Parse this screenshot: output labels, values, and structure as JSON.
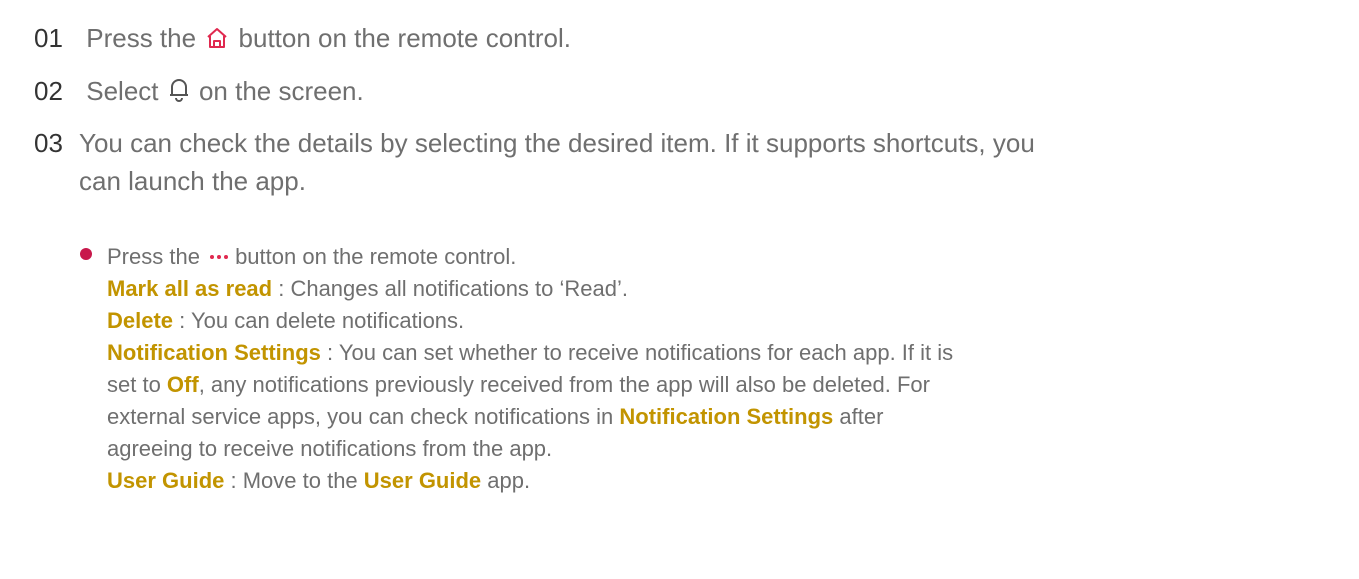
{
  "steps": [
    {
      "num": "01",
      "pre": "Press the",
      "icon": "home-icon",
      "post": "button on the remote control."
    },
    {
      "num": "02",
      "pre": "Select",
      "icon": "bell-icon",
      "post": "on the screen."
    },
    {
      "num": "03",
      "line1": "You can check the details by selecting the desired item. If it supports shortcuts, you",
      "line2": "can launch the app."
    }
  ],
  "bullet": {
    "press_pre": "Press the",
    "icon": "more-dots-icon",
    "press_post": "button on the remote control.",
    "items": [
      {
        "term": "Mark all as read",
        "desc": " : Changes all notifications to ‘Read’."
      },
      {
        "term": "Delete",
        "desc": " : You can delete notifications."
      }
    ],
    "notif": {
      "term": "Notification Settings",
      "desc1": " : You can set whether to receive notifications for each app. If it is",
      "desc2_pre": "set to ",
      "off": "Off",
      "desc2_post": ", any notifications previously received from the app will also be deleted. For",
      "desc3_pre": "external service apps, you can check notifications in ",
      "term2": "Notification Settings",
      "desc3_post": " after",
      "desc4": "agreeing to receive notifications from the app."
    },
    "guide": {
      "term": "User Guide",
      "desc_pre": " : Move to the ",
      "term2": "User Guide",
      "desc_post": " app."
    }
  },
  "colors": {
    "accent_term": "#c29400",
    "bullet": "#c8184b",
    "icon_red": "#e0294f"
  }
}
